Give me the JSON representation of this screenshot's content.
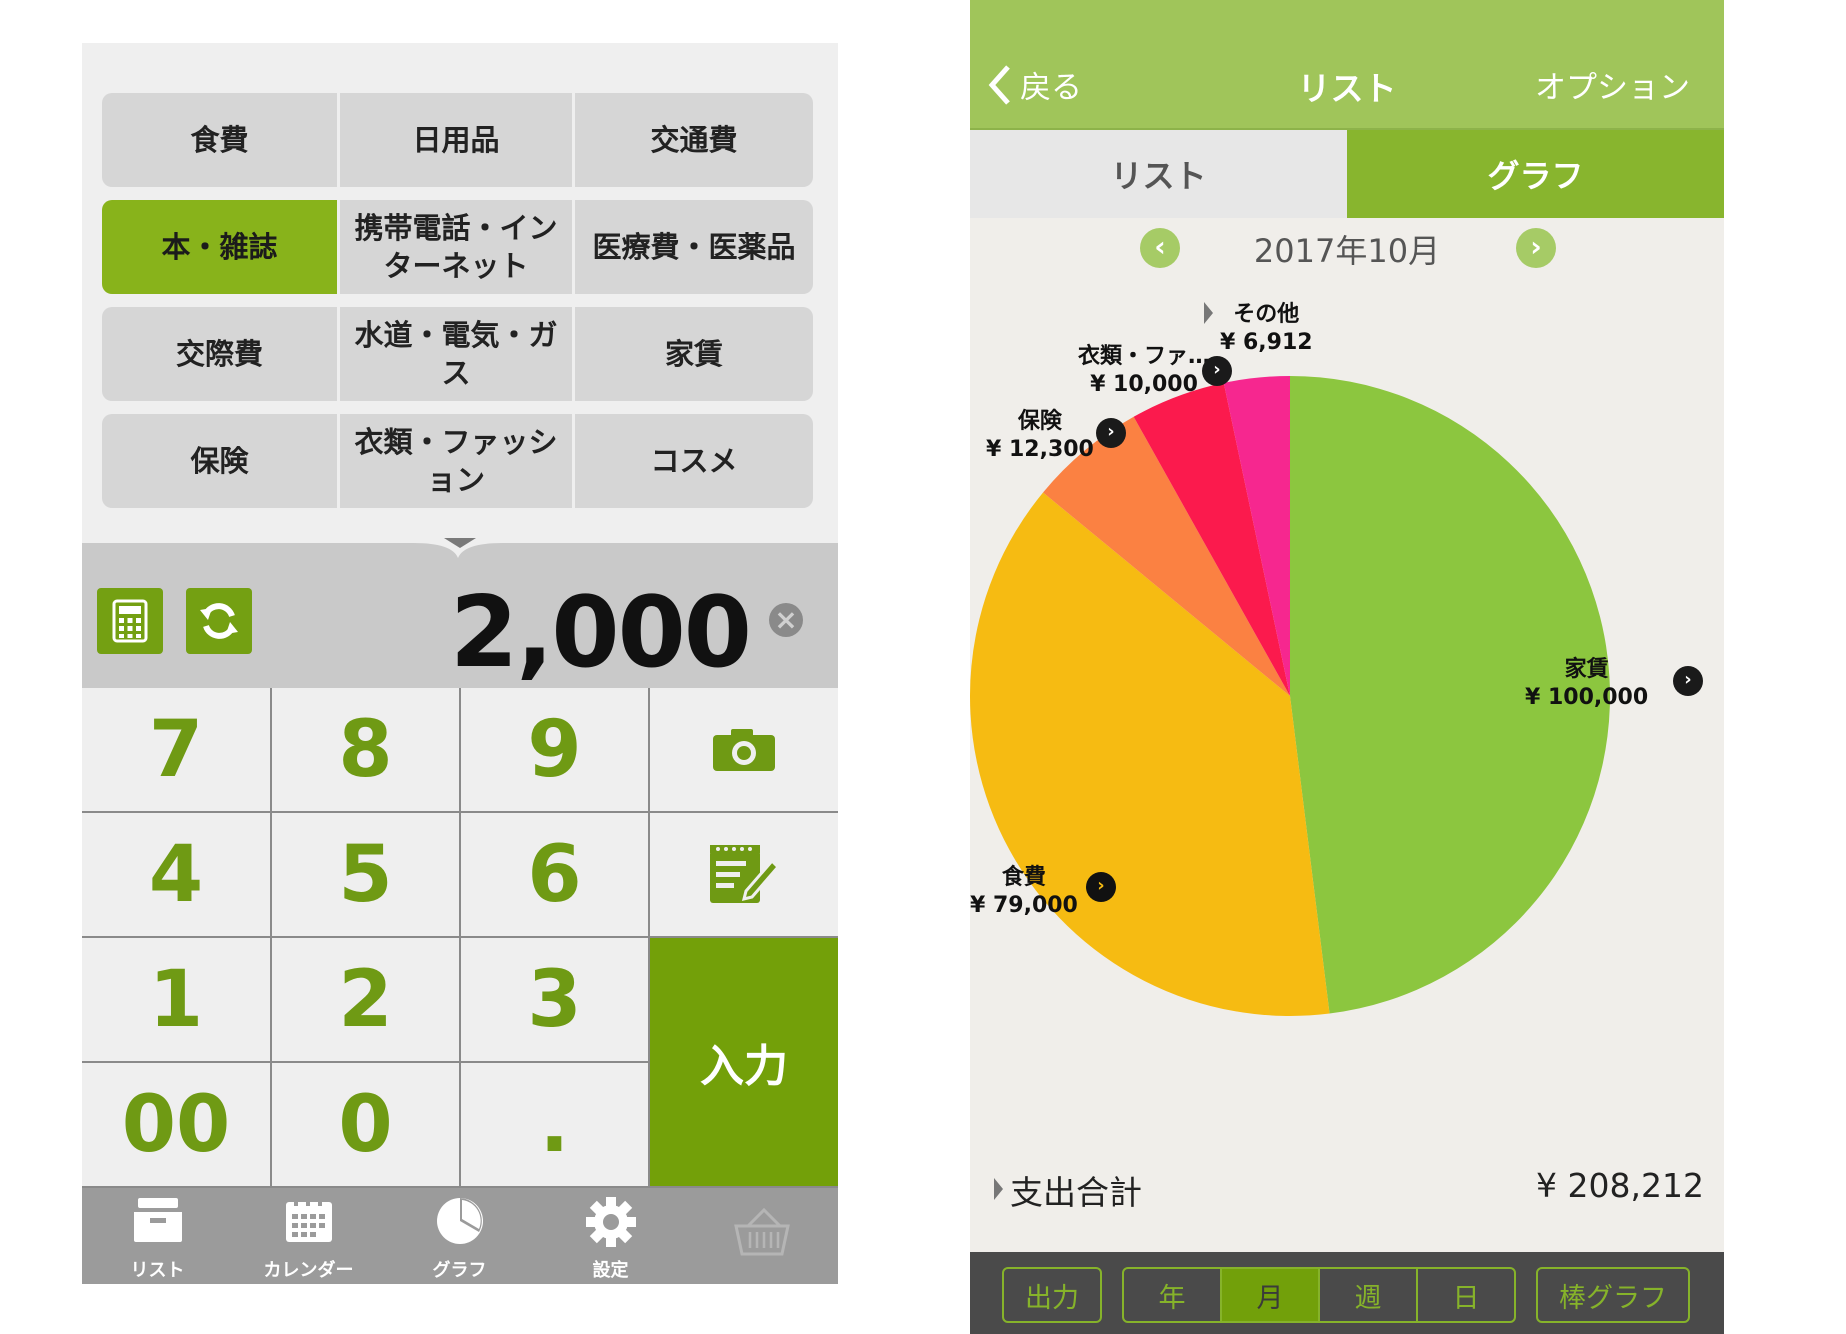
{
  "left": {
    "categories": [
      [
        "食費",
        "日用品",
        "交通費"
      ],
      [
        "本・雑誌",
        "携帯電話・インターネット",
        "医療費・医薬品"
      ],
      [
        "交際費",
        "水道・電気・ガス",
        "家賃"
      ],
      [
        "保険",
        "衣類・ファッション",
        "コスメ"
      ]
    ],
    "selected_category": "本・雑誌",
    "amount": "2,000",
    "keys": {
      "k7": "7",
      "k8": "8",
      "k9": "9",
      "k4": "4",
      "k5": "5",
      "k6": "6",
      "k1": "1",
      "k2": "2",
      "k3": "3",
      "k00": "00",
      "k0": "0",
      "kdot": ".",
      "enter": "入力"
    },
    "tabs": {
      "list": "リスト",
      "calendar": "カレンダー",
      "graph": "グラフ",
      "settings": "設定"
    },
    "colors": {
      "accent": "#74a012",
      "key_text": "#6f9a14",
      "tabbar": "#9b9b9b"
    }
  },
  "right": {
    "nav": {
      "back": "戻る",
      "title": "リスト",
      "option": "オプション"
    },
    "segments": {
      "list": "リスト",
      "graph": "グラフ"
    },
    "month": "2017年10月",
    "total_label": "支出合計",
    "total_value": "¥ 208,212",
    "bottom": {
      "export": "出力",
      "year": "年",
      "month": "月",
      "week": "週",
      "day": "日",
      "bar_graph": "棒グラフ"
    },
    "labels": {
      "rent_name": "家賃",
      "rent_value": "¥ 100,000",
      "food_name": "食費",
      "food_value": "¥ 79,000",
      "insurance_name": "保険",
      "insurance_value": "¥ 12,300",
      "clothing_name": "衣類・ファ…",
      "clothing_value": "¥ 10,000",
      "other_name": "その他",
      "other_value": "¥ 6,912"
    }
  },
  "chart_data": {
    "type": "pie",
    "categories": [
      "家賃",
      "食費",
      "保険",
      "衣類・ファ…",
      "その他"
    ],
    "values": [
      100000,
      79000,
      12300,
      10000,
      6912
    ],
    "colors": [
      "#8cc63f",
      "#f6bb12",
      "#fb8142",
      "#fb1a4d",
      "#f6278f"
    ],
    "total": 208212
  }
}
